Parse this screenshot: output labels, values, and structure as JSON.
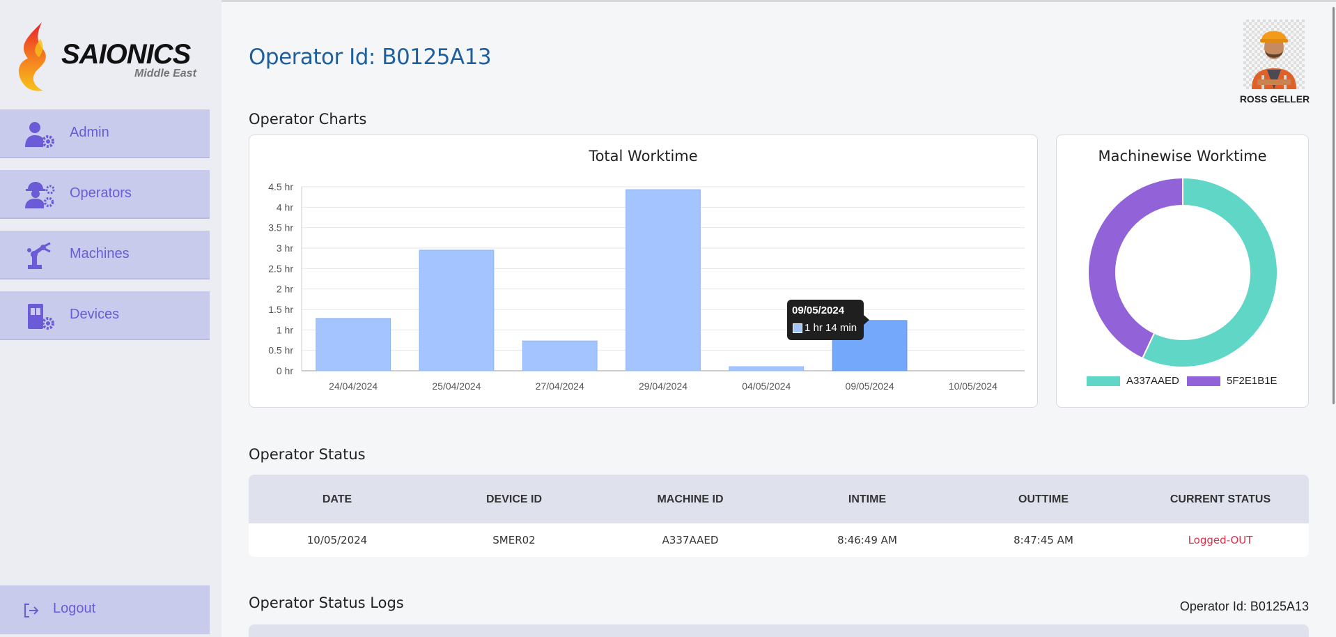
{
  "brand": {
    "name": "SAIONICS",
    "subtitle": "Middle East"
  },
  "nav": {
    "items": [
      {
        "label": "Admin",
        "icon": "admin-gear-icon"
      },
      {
        "label": "Operators",
        "icon": "operators-gear-icon"
      },
      {
        "label": "Machines",
        "icon": "robot-arm-icon"
      },
      {
        "label": "Devices",
        "icon": "device-gear-icon"
      }
    ],
    "logout": {
      "label": "Logout",
      "icon": "logout-icon"
    }
  },
  "header": {
    "title": "Operator Id: B0125A13",
    "user_name": "ROSS GELLER"
  },
  "charts_section": {
    "title": "Operator Charts"
  },
  "worktime_chart": {
    "title": "Total Worktime",
    "tooltip": {
      "date": "09/05/2024",
      "value": "1 hr 14 min"
    }
  },
  "machine_chart": {
    "title": "Machinewise Worktime"
  },
  "chart_data": [
    {
      "type": "bar",
      "title": "Total Worktime",
      "categories": [
        "24/04/2024",
        "25/04/2024",
        "27/04/2024",
        "29/04/2024",
        "04/05/2024",
        "09/05/2024",
        "10/05/2024"
      ],
      "values": [
        1.28,
        2.95,
        0.73,
        4.43,
        0.1,
        1.23,
        0.0
      ],
      "ylim": [
        0,
        4.5
      ],
      "yticks": [
        "0 hr",
        "0.5 hr",
        "1 hr",
        "1.5 hr",
        "2 hr",
        "2.5 hr",
        "3 hr",
        "3.5 hr",
        "4 hr",
        "4.5 hr"
      ],
      "highlighted_category": "09/05/2024",
      "color": "#a3c4ff",
      "highlight_color": "#74a8fb",
      "grid": true
    },
    {
      "type": "pie",
      "title": "Machinewise Worktime",
      "categories": [
        "A337AAED",
        "5F2E1B1E"
      ],
      "values": [
        57,
        43
      ],
      "colors": [
        "#5fd6c6",
        "#9162d8"
      ],
      "donut": true,
      "legend": "bottom"
    }
  ],
  "status_section": {
    "title": "Operator Status",
    "columns": [
      "DATE",
      "DEVICE ID",
      "MACHINE ID",
      "INTIME",
      "OUTTIME",
      "CURRENT STATUS"
    ],
    "rows": [
      [
        "10/05/2024",
        "SMER02",
        "A337AAED",
        "8:46:49 AM",
        "8:47:45 AM",
        "Logged-OUT"
      ]
    ],
    "status_color": "#e03048"
  },
  "logs_section": {
    "title": "Operator Status Logs",
    "operator_label": "Operator Id: B0125A13"
  },
  "colors": {
    "accent": "#1e5f9e",
    "nav_bg": "#c9cbed",
    "nav_text": "#6b5bd6"
  }
}
